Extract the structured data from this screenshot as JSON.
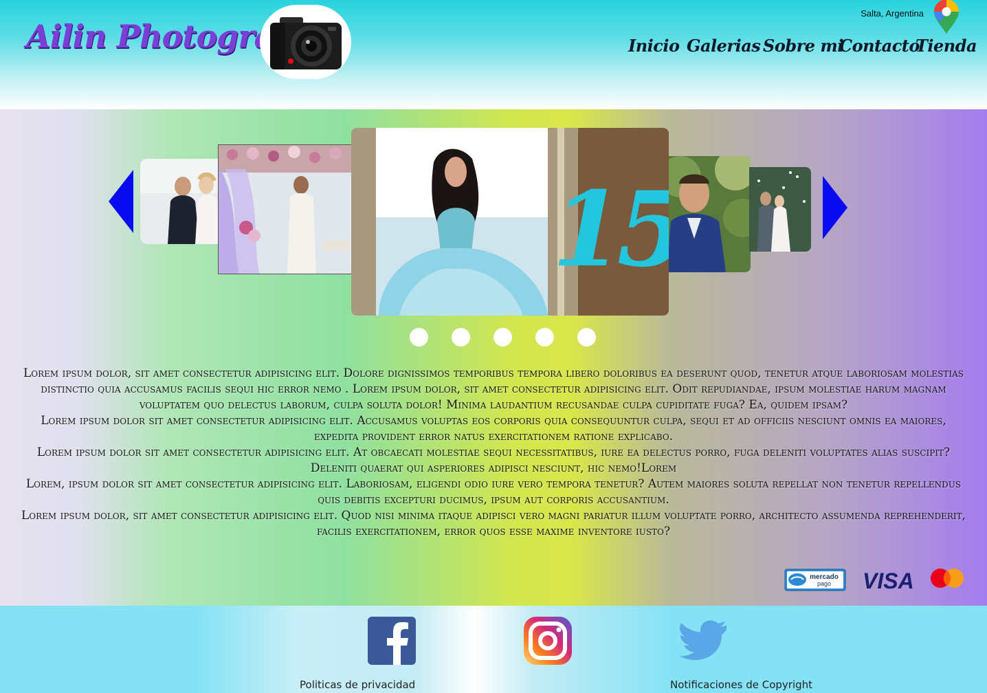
{
  "header": {
    "brand": "Ailin Photografh",
    "location": "Salta, Argentina",
    "nav": [
      {
        "label": "Inicio"
      },
      {
        "label": "Galerias"
      },
      {
        "label": "Sobre mi"
      },
      {
        "label": "Contacto"
      },
      {
        "label": "Tienda"
      }
    ]
  },
  "carousel": {
    "center_badge": "15",
    "dot_count": 5
  },
  "content": {
    "paragraphs": [
      "Lorem ipsum dolor, sit amet consectetur adipisicing elit. Dolore dignissimos temporibus tempora libero doloribus ea deserunt quod, tenetur atque laboriosam molestias distinctio quia accusamus facilis sequi hic error nemo . Lorem ipsum dolor, sit amet consectetur adipisicing elit. Odit repudiandae, ipsum molestiae harum magnam voluptatem quo delectus laborum, culpa soluta dolor! Minima laudantium recusandae culpa cupiditate fuga? Ea, quidem ipsam?",
      "Lorem ipsum dolor sit amet consectetur adipisicing elit. Accusamus voluptas eos corporis quia consequuntur culpa, sequi et ad officiis nesciunt omnis ea maiores, expedita provident error natus exercitationem ratione explicabo.",
      "Lorem ipsum dolor sit amet consectetur adipisicing elit. At obcaecati molestiae sequi necessitatibus, iure ea delectus porro, fuga deleniti voluptates alias suscipit? Deleniti quaerat qui asperiores adipisci nesciunt, hic nemo!Lorem",
      "Lorem, ipsum dolor sit amet consectetur adipisicing elit. Laboriosam, eligendi odio iure vero tempora tenetur? Autem maiores soluta repellat non tenetur repellendus quis debitis excepturi ducimus, ipsum aut corporis accusantium.",
      "Lorem ipsum dolor, sit amet consectetur adipisicing elit. Quod nisi minima itaque adipisci vero magni pariatur illum voluptate porro, architecto assumenda reprehenderit, facilis exercitationem, error quos esse maxime inventore iusto?"
    ]
  },
  "payments": {
    "mercadopago_line1": "mercado",
    "mercadopago_line2": "pago",
    "visa": "VISA"
  },
  "footer": {
    "privacy": "Politicas de privacidad",
    "copyright": "Notificaciones de Copyright"
  },
  "colors": {
    "brand": "#7a3fd6",
    "arrow": "#0a0af0",
    "facebook": "#3b5998",
    "twitter": "#5aa6e6"
  },
  "icons": [
    "camera-icon",
    "maps-pin-icon",
    "arrow-left-icon",
    "arrow-right-icon",
    "facebook-icon",
    "instagram-icon",
    "twitter-icon",
    "mercadopago-logo",
    "visa-logo",
    "mastercard-logo"
  ]
}
